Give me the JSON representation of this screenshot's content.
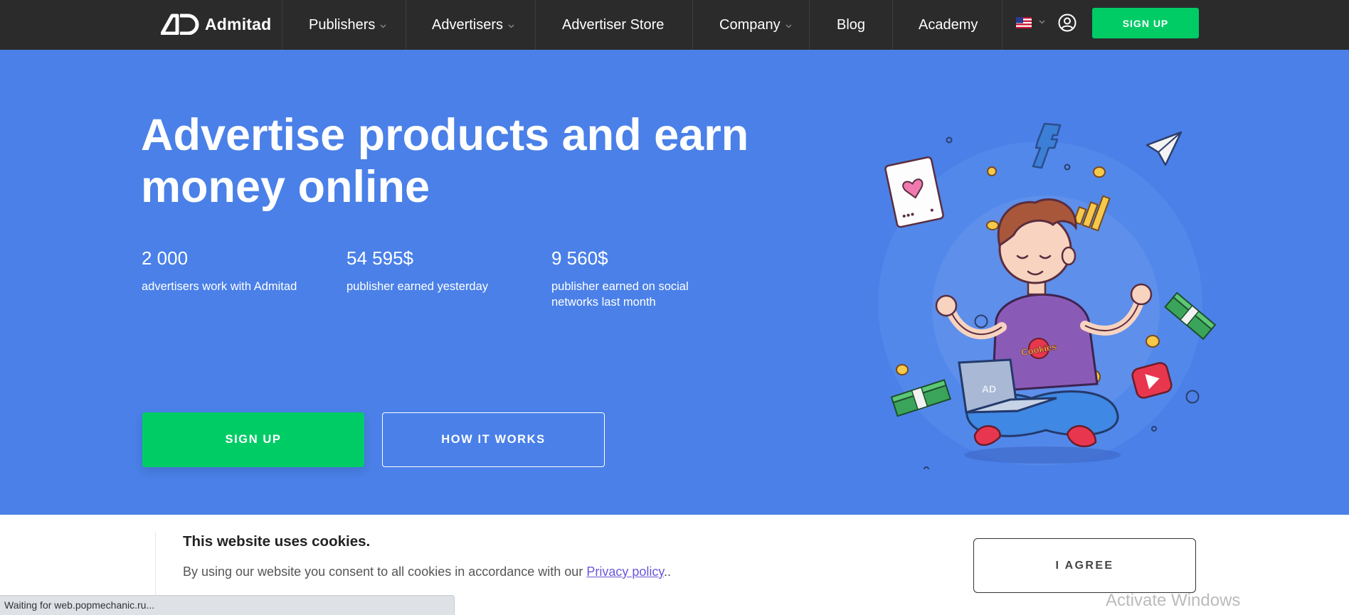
{
  "brand": {
    "name": "Admitad"
  },
  "nav": {
    "items": [
      {
        "label": "Publishers",
        "has_dropdown": true
      },
      {
        "label": "Advertisers",
        "has_dropdown": true
      },
      {
        "label": "Advertiser Store",
        "has_dropdown": false
      },
      {
        "label": "Company",
        "has_dropdown": true
      },
      {
        "label": "Blog",
        "has_dropdown": false
      },
      {
        "label": "Academy",
        "has_dropdown": false
      }
    ],
    "language_icon": "us-flag-icon",
    "account_icon": "user-icon",
    "signup_label": "SIGN UP"
  },
  "hero": {
    "title": "Advertise products and earn money online",
    "stats": [
      {
        "value": "2 000",
        "label": "advertisers work with Admitad"
      },
      {
        "value": "54 595$",
        "label": "publisher earned yesterday"
      },
      {
        "value": "9 560$",
        "label": "publisher earned on social networks last month"
      }
    ],
    "primary_button": "SIGN UP",
    "secondary_button": "HOW IT WORKS",
    "illustration_text": "Cookies"
  },
  "cookie_banner": {
    "title": "This website uses cookies.",
    "text": "By using our website you consent to all cookies in accordance with our",
    "link_text": "Privacy policy",
    "text_suffix": "..",
    "agree_button": "I AGREE"
  },
  "status_bar": {
    "text": "Waiting for web.popmechanic.ru..."
  },
  "watermark": {
    "text": "Activate Windows"
  },
  "colors": {
    "nav_bg": "#2b2b2b",
    "hero_bg": "#4a80e8",
    "accent_green": "#00cc66",
    "link_purple": "#6a58d8"
  }
}
